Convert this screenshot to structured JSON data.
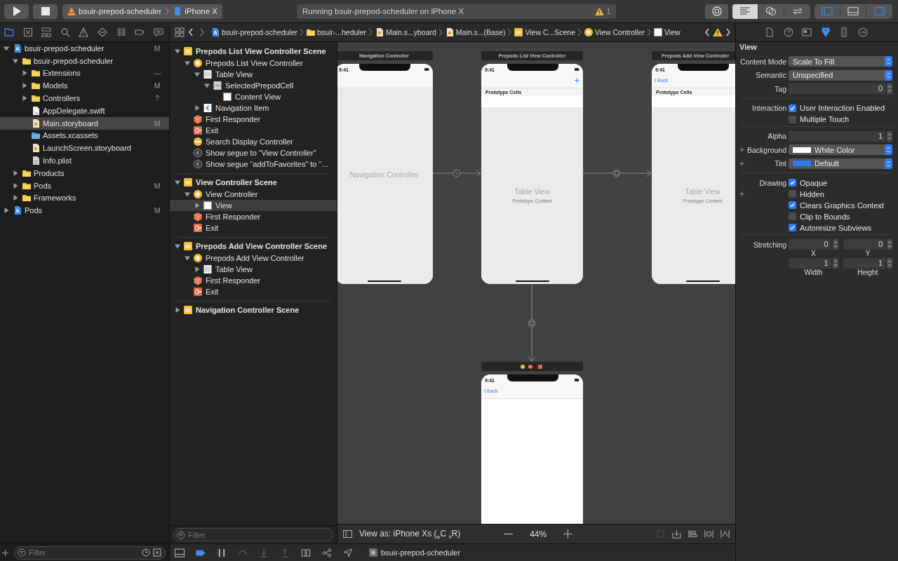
{
  "toolbar": {
    "scheme": "bsuir-prepod-scheduler",
    "device": "iPhone X",
    "status": "Running bsuir-prepod-scheduler on iPhone X",
    "warning_count": "1",
    "editor_modes": [
      {
        "kind": "standard",
        "selected": true
      },
      {
        "kind": "assistant",
        "selected": false
      },
      {
        "kind": "version",
        "selected": false
      }
    ],
    "panels": [
      {
        "kind": "navigator",
        "selected": true
      },
      {
        "kind": "debug",
        "selected": false
      },
      {
        "kind": "inspector",
        "selected": true
      }
    ]
  },
  "navigator_tabs": [
    {
      "kind": "project",
      "selected": true
    },
    {
      "kind": "source",
      "selected": false
    },
    {
      "kind": "symbol",
      "selected": false
    },
    {
      "kind": "find",
      "selected": false
    },
    {
      "kind": "issue",
      "selected": false
    },
    {
      "kind": "test",
      "selected": false
    },
    {
      "kind": "debug",
      "selected": false
    },
    {
      "kind": "breakpoint",
      "selected": false
    },
    {
      "kind": "report",
      "selected": false
    }
  ],
  "jump_bar": [
    {
      "kind": "project",
      "label": "bsuir-prepod-scheduler"
    },
    {
      "kind": "folder",
      "label": "bsuir-...heduler"
    },
    {
      "kind": "storyboard",
      "label": "Main.s...yboard"
    },
    {
      "kind": "storyboard",
      "label": "Main.s...(Base)"
    },
    {
      "kind": "scene",
      "label": "View C...Scene"
    },
    {
      "kind": "controller",
      "label": "View Controller"
    },
    {
      "kind": "view",
      "label": "View"
    }
  ],
  "inspector_tabs": [
    {
      "kind": "file",
      "selected": false
    },
    {
      "kind": "help",
      "selected": false
    },
    {
      "kind": "identity",
      "selected": false
    },
    {
      "kind": "attributes",
      "selected": true
    },
    {
      "kind": "size",
      "selected": false
    },
    {
      "kind": "connections",
      "selected": false
    }
  ],
  "navigator": {
    "items": [
      {
        "kind": "project",
        "label": "bsuir-prepod-scheduler",
        "status": "M",
        "expanded": true,
        "selected": false,
        "children": [
          {
            "kind": "folder",
            "label": "bsuir-prepod-scheduler",
            "expanded": true,
            "selected": false,
            "children": [
              {
                "kind": "folder",
                "label": "Extensions",
                "status": "—",
                "expanded": false,
                "selected": false
              },
              {
                "kind": "folder",
                "label": "Models",
                "status": "M",
                "expanded": false,
                "selected": false
              },
              {
                "kind": "folder",
                "label": "Controllers",
                "status": "?",
                "expanded": false,
                "selected": false
              },
              {
                "kind": "swift",
                "label": "AppDelegate.swift",
                "selected": false
              },
              {
                "kind": "storyboard",
                "label": "Main.storyboard",
                "status": "M",
                "selected": true
              },
              {
                "kind": "assets",
                "label": "Assets.xcassets",
                "selected": false
              },
              {
                "kind": "storyboard",
                "label": "LaunchScreen.storyboard",
                "selected": false
              },
              {
                "kind": "plist",
                "label": "Info.plist",
                "selected": false
              }
            ]
          },
          {
            "kind": "folder",
            "label": "Products",
            "expanded": false,
            "selected": false
          },
          {
            "kind": "folder",
            "label": "Pods",
            "status": "M",
            "expanded": false,
            "selected": false
          },
          {
            "kind": "folder",
            "label": "Frameworks",
            "expanded": false,
            "selected": false
          }
        ]
      },
      {
        "kind": "project",
        "label": "Pods",
        "status": "M",
        "expanded": false,
        "selected": false
      }
    ],
    "filter_placeholder": "Filter"
  },
  "outline": {
    "sections": [
      {
        "kind": "scene",
        "label": "Prepods List View Controller Scene",
        "expanded": true,
        "selected": false,
        "children": [
          {
            "kind": "controller",
            "label": "Prepods List View Controller",
            "expanded": true,
            "selected": false,
            "children": [
              {
                "kind": "table",
                "label": "Table View",
                "expanded": true,
                "selected": false,
                "children": [
                  {
                    "kind": "cell",
                    "label": "SelectedPrepodCell",
                    "expanded": true,
                    "selected": false,
                    "children": [
                      {
                        "kind": "view",
                        "label": "Content View",
                        "selected": false
                      }
                    ]
                  }
                ]
              },
              {
                "kind": "navitem",
                "label": "Navigation Item",
                "expanded": false,
                "selected": false
              }
            ]
          },
          {
            "kind": "responder",
            "label": "First Responder",
            "selected": false
          },
          {
            "kind": "exit",
            "label": "Exit",
            "selected": false
          },
          {
            "kind": "search",
            "label": "Search Display Controller",
            "selected": false
          },
          {
            "kind": "segue",
            "label": "Show segue to “View Controller”",
            "selected": false
          },
          {
            "kind": "segue",
            "label": "Show segue “addToFavorites” to “…",
            "selected": false
          }
        ]
      },
      {
        "kind": "scene",
        "label": "View Controller Scene",
        "expanded": true,
        "selected": false,
        "children": [
          {
            "kind": "controller",
            "label": "View Controller",
            "expanded": true,
            "selected": false,
            "children": [
              {
                "kind": "view",
                "label": "View",
                "expanded": false,
                "selected": true
              }
            ]
          },
          {
            "kind": "responder",
            "label": "First Responder",
            "selected": false
          },
          {
            "kind": "exit",
            "label": "Exit",
            "selected": false
          }
        ]
      },
      {
        "kind": "scene",
        "label": "Prepods Add View Controller Scene",
        "expanded": true,
        "selected": false,
        "children": [
          {
            "kind": "controller",
            "label": "Prepods Add View Controller",
            "expanded": true,
            "selected": false,
            "children": [
              {
                "kind": "table",
                "label": "Table View",
                "expanded": false,
                "selected": false
              }
            ]
          },
          {
            "kind": "responder",
            "label": "First Responder",
            "selected": false
          },
          {
            "kind": "exit",
            "label": "Exit",
            "selected": false
          }
        ]
      },
      {
        "kind": "scene",
        "label": "Navigation Controller Scene",
        "expanded": false,
        "selected": false
      }
    ],
    "filter_placeholder": "Filter"
  },
  "canvas": {
    "scenes": [
      {
        "kind": "navigation",
        "title": "Navigation Controller",
        "time": "9:41",
        "center_title": "Navigation Controller"
      },
      {
        "kind": "table",
        "title": "Prepods List View Controller",
        "time": "9:41",
        "bar_button": "+",
        "section_header": "Prototype Cells",
        "center_title": "Table View",
        "center_subtitle": "Prototype Content"
      },
      {
        "kind": "table",
        "title": "Prepods Add View Controller",
        "time": "9:41",
        "back_button": "Back",
        "section_header": "Prototype Cells",
        "center_title": "Table View",
        "center_subtitle": "Prototype Content"
      },
      {
        "kind": "plain",
        "time": "9:41",
        "back_button": "Back"
      }
    ],
    "view_as": "View as: iPhone Xs ($_{w}$C $_{h}$R)",
    "zoom": "44%"
  },
  "inspector": {
    "title": "View",
    "groups": [
      [
        {
          "kind": "popup",
          "label": "Content Mode",
          "value": "Scale To Fill"
        },
        {
          "kind": "popup",
          "label": "Semantic",
          "value": "Unspecified"
        },
        {
          "kind": "stepper",
          "label": "Tag",
          "value": "0"
        }
      ],
      [
        {
          "kind": "check",
          "label": "Interaction",
          "text": "User Interaction Enabled",
          "checked": true
        },
        {
          "kind": "check",
          "text": "Multiple Touch",
          "checked": false
        }
      ],
      [
        {
          "kind": "stepper",
          "label": "Alpha",
          "value": "1"
        },
        {
          "kind": "color",
          "label": "Background",
          "value": "White Color",
          "color": "#ffffff",
          "add": true
        },
        {
          "kind": "color",
          "label": "Tint",
          "value": "Default",
          "color": "#2f7cf6",
          "add": true
        }
      ],
      [
        {
          "kind": "check",
          "label": "Drawing",
          "text": "Opaque",
          "checked": true
        },
        {
          "kind": "check",
          "text": "Hidden",
          "checked": false,
          "add": true
        },
        {
          "kind": "check",
          "text": "Clears Graphics Context",
          "checked": true
        },
        {
          "kind": "check",
          "text": "Clip to Bounds",
          "checked": false
        },
        {
          "kind": "check",
          "text": "Autoresize Subviews",
          "checked": true
        }
      ],
      [
        {
          "kind": "pair",
          "label": "Stretching",
          "fields": [
            {
              "value": "0",
              "caption": "X"
            },
            {
              "value": "0",
              "caption": "Y"
            }
          ]
        },
        {
          "kind": "pair",
          "fields": [
            {
              "value": "1",
              "caption": "Width"
            },
            {
              "value": "1",
              "caption": "Height"
            }
          ]
        }
      ]
    ]
  },
  "debug_bar": {
    "breakpoints_active": true,
    "target": "bsuir-prepod-scheduler"
  }
}
